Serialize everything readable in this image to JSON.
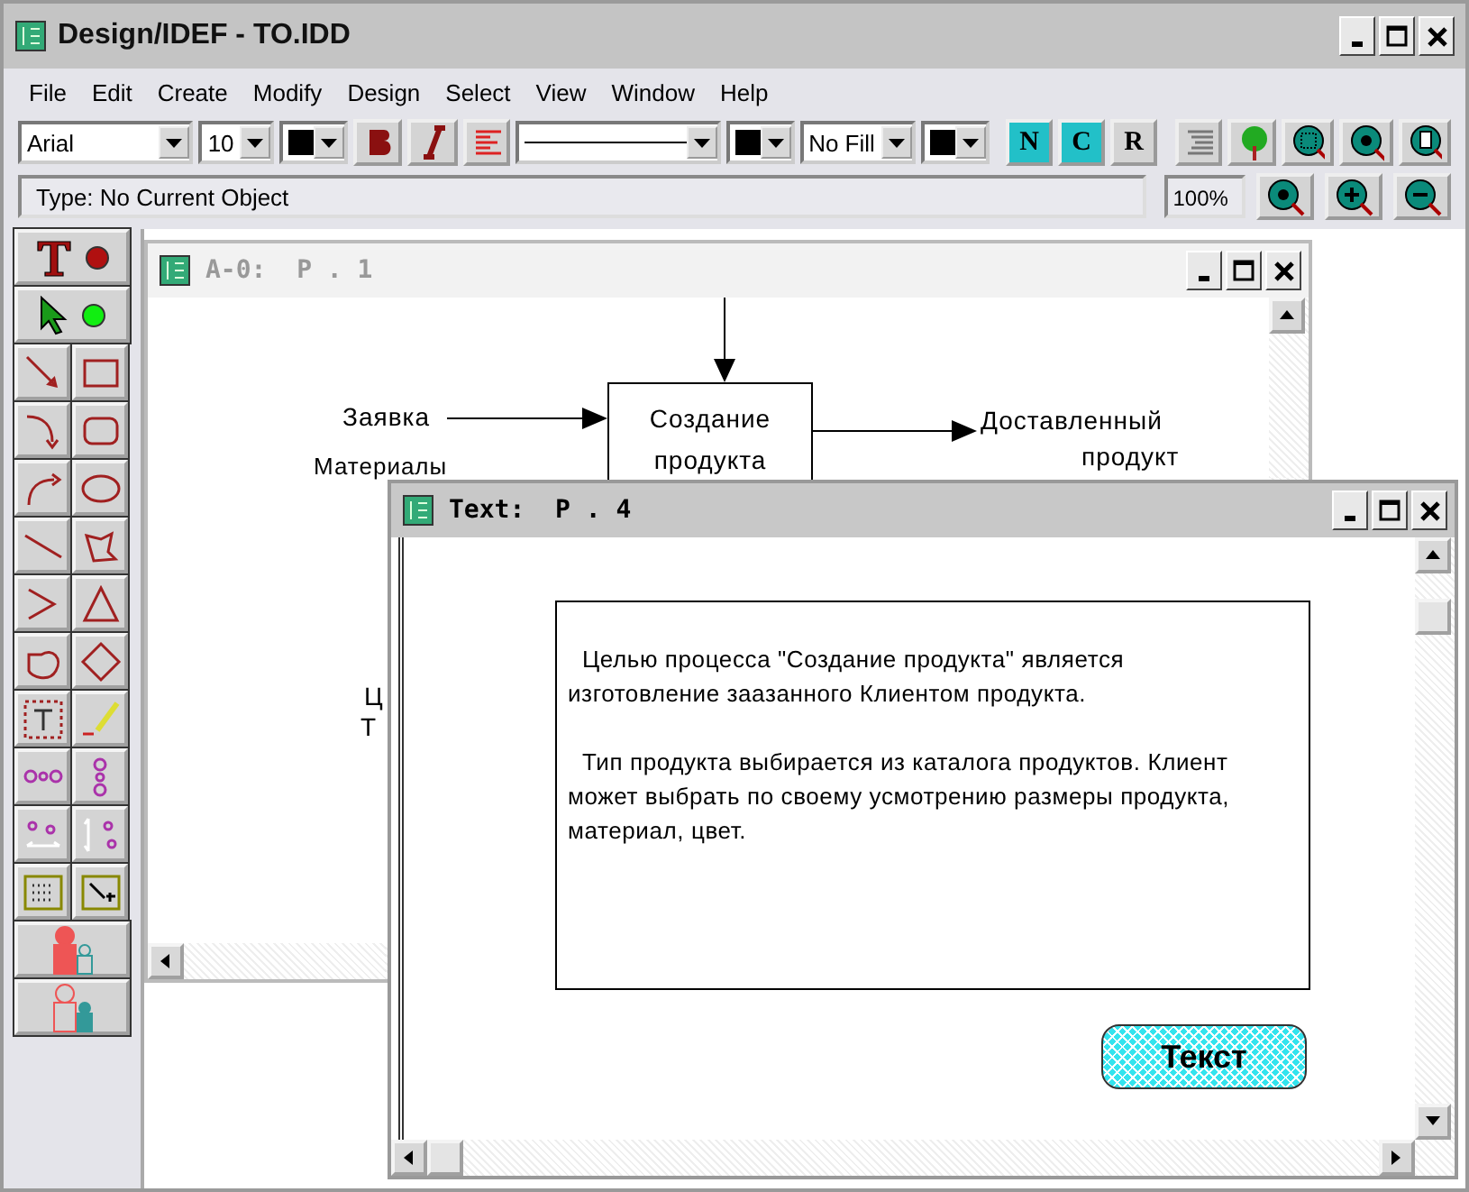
{
  "window": {
    "title": "Design/IDEF - TO.IDD"
  },
  "menu": [
    "File",
    "Edit",
    "Create",
    "Modify",
    "Design",
    "Select",
    "View",
    "Window",
    "Help"
  ],
  "toolbar": {
    "font": "Arial",
    "size": "10",
    "fill": "No Fill",
    "modes": [
      {
        "label": "N",
        "selected": true
      },
      {
        "label": "C",
        "selected": true
      },
      {
        "label": "R",
        "selected": false
      }
    ]
  },
  "status": {
    "type_text": "Type: No Current Object",
    "zoom": "100%"
  },
  "diagram_window": {
    "title": "A-0:  P . 1",
    "box_lines": [
      "Создание",
      "продукта"
    ],
    "input_1": "Заявка",
    "input_2": "Материалы",
    "output_1": "Доставленный",
    "output_2": "продукт",
    "fragment_1": "Ц",
    "fragment_2": "Т"
  },
  "text_window": {
    "title": "Text:  P . 4",
    "paragraphs": [
      "Целью процесса \"Создание продукта\" является изготовление заазанного Клиентом продукта.",
      "Тип продукта выбирается из каталога продуктов. Клиент может выбрать по своему усмотрению размеры продукта, материал, цвет."
    ],
    "button": "Текст"
  }
}
